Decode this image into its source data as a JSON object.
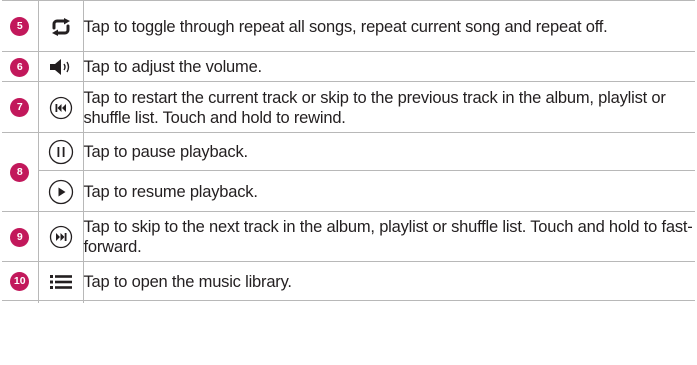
{
  "rows": [
    {
      "number": "5",
      "icon": "repeat-icon",
      "text": "Tap to toggle through repeat all songs, repeat current song and repeat off."
    },
    {
      "number": "6",
      "icon": "volume-icon",
      "text": "Tap to adjust the volume."
    },
    {
      "number": "7",
      "icon": "previous-track-icon",
      "text": "Tap to restart the current track or skip to the previous track in the album, playlist or shuffle list. Touch and hold to rewind."
    },
    {
      "number": "8",
      "sub": [
        {
          "icon": "pause-icon",
          "text": "Tap to pause playback."
        },
        {
          "icon": "play-icon",
          "text": "Tap to resume playback."
        }
      ]
    },
    {
      "number": "9",
      "icon": "next-track-icon",
      "text": "Tap to skip to the next track in the album, playlist or shuffle list. Touch and hold to fast-forward."
    },
    {
      "number": "10",
      "icon": "music-library-icon",
      "text": "Tap to open the music library."
    }
  ],
  "colors": {
    "badge": "#c2185b",
    "rule": "#b8b8b8",
    "text": "#231f20"
  }
}
